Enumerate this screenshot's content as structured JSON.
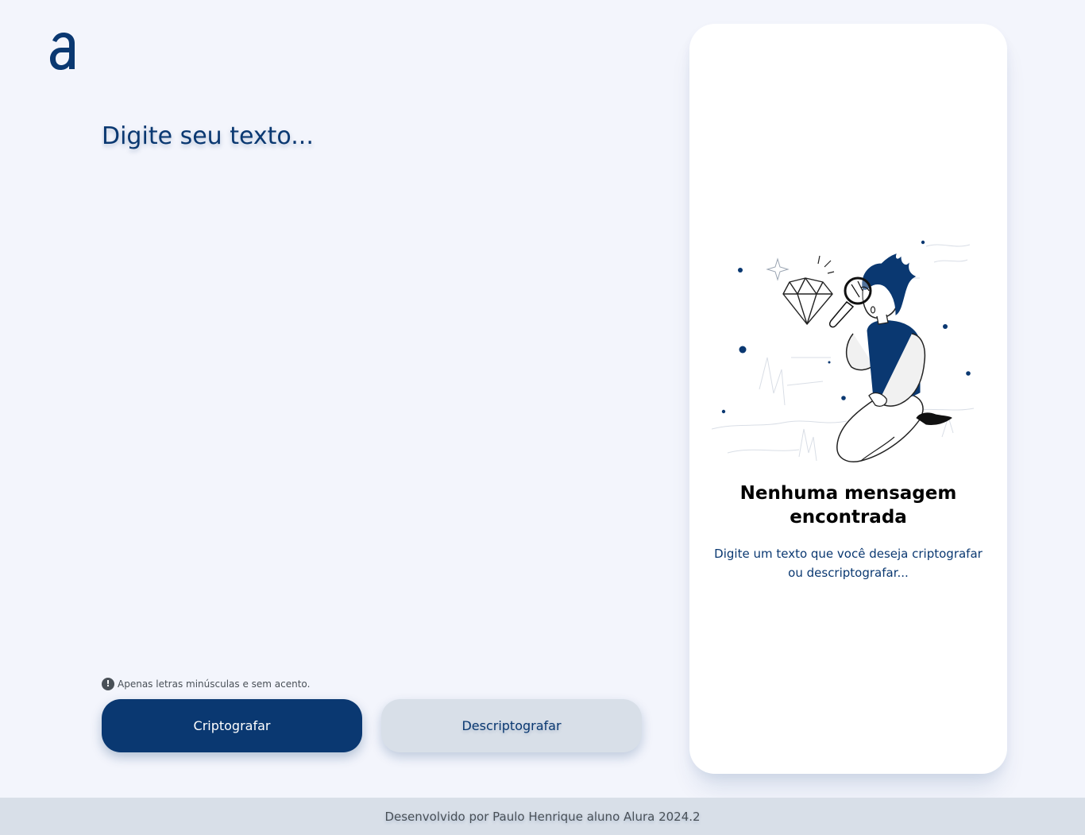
{
  "logo": {
    "icon": "alura-logo-icon",
    "color": "#0A3871"
  },
  "input": {
    "placeholder": "Digite seu texto..."
  },
  "hint": {
    "icon": "exclamation-circle-icon",
    "text": "Apenas letras minúsculas e sem acento."
  },
  "buttons": {
    "encrypt": "Criptografar",
    "decrypt": "Descriptografar"
  },
  "output": {
    "illustration": "person-with-magnifier-and-diamond-illustration",
    "title": "Nenhuma mensagem encontrada",
    "text": "Digite um texto que você deseja criptografar ou descriptografar..."
  },
  "footer": {
    "text": "Desenvolvido por Paulo Henrique aluno Alura 2024.2"
  },
  "colors": {
    "primary": "#0A3871",
    "background": "#F3F5FC",
    "secondary_button": "#D8DFE8",
    "footer_bg": "#D8DFE8",
    "card_bg": "#FFFFFF"
  }
}
